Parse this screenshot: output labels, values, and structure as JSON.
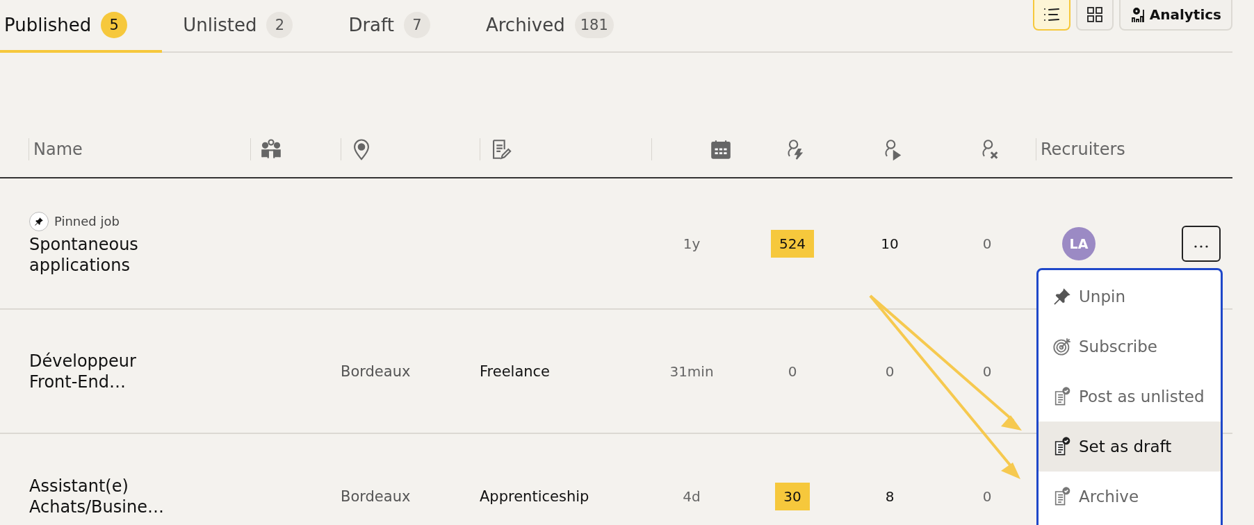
{
  "tabs": [
    {
      "label": "Published",
      "count": "5",
      "selected": true
    },
    {
      "label": "Unlisted",
      "count": "2",
      "selected": false
    },
    {
      "label": "Draft",
      "count": "7",
      "selected": false
    },
    {
      "label": "Archived",
      "count": "181",
      "selected": false
    }
  ],
  "toolbar": {
    "views": [
      {
        "selected": true
      },
      {
        "selected": false
      }
    ],
    "analytics_label": "Analytics"
  },
  "table": {
    "columns": [
      {
        "kind": "text",
        "label": "Name"
      },
      {
        "kind": "icon"
      },
      {
        "kind": "icon"
      },
      {
        "kind": "icon"
      },
      {
        "kind": "icon"
      },
      {
        "kind": "icon"
      },
      {
        "kind": "icon"
      },
      {
        "kind": "icon"
      },
      {
        "kind": "text",
        "label": "Recruiters"
      }
    ],
    "rows": [
      {
        "pin_label": "Pinned job",
        "name": "Spontaneous applications",
        "age": "1y",
        "metrics": [
          {
            "value": "524",
            "highlighted": true,
            "muted": false
          },
          {
            "value": "10",
            "highlighted": false,
            "muted": false
          },
          {
            "value": "0",
            "highlighted": false,
            "muted": true
          }
        ],
        "recruiter_initials": "LA",
        "has_menu_button": true
      },
      {
        "name": "Développeur Front-End…",
        "location": "Bordeaux",
        "contract": "Freelance",
        "age": "31min",
        "metrics": [
          {
            "value": "0",
            "highlighted": false,
            "muted": true
          },
          {
            "value": "0",
            "highlighted": false,
            "muted": true
          },
          {
            "value": "0",
            "highlighted": false,
            "muted": true
          }
        ]
      },
      {
        "name": "Assistant(e) Achats/Busine…",
        "location": "Bordeaux",
        "contract": "Apprenticeship",
        "age": "4d",
        "metrics": [
          {
            "value": "30",
            "highlighted": true,
            "muted": false
          },
          {
            "value": "8",
            "highlighted": false,
            "muted": false
          },
          {
            "value": "0",
            "highlighted": false,
            "muted": true
          }
        ]
      }
    ]
  },
  "menu": {
    "items": [
      {
        "label": "Unpin",
        "selected": false
      },
      {
        "label": "Subscribe",
        "selected": false
      },
      {
        "label": "Post as unlisted",
        "selected": false
      },
      {
        "label": "Set as draft",
        "selected": true
      },
      {
        "label": "Archive",
        "selected": false
      }
    ]
  }
}
